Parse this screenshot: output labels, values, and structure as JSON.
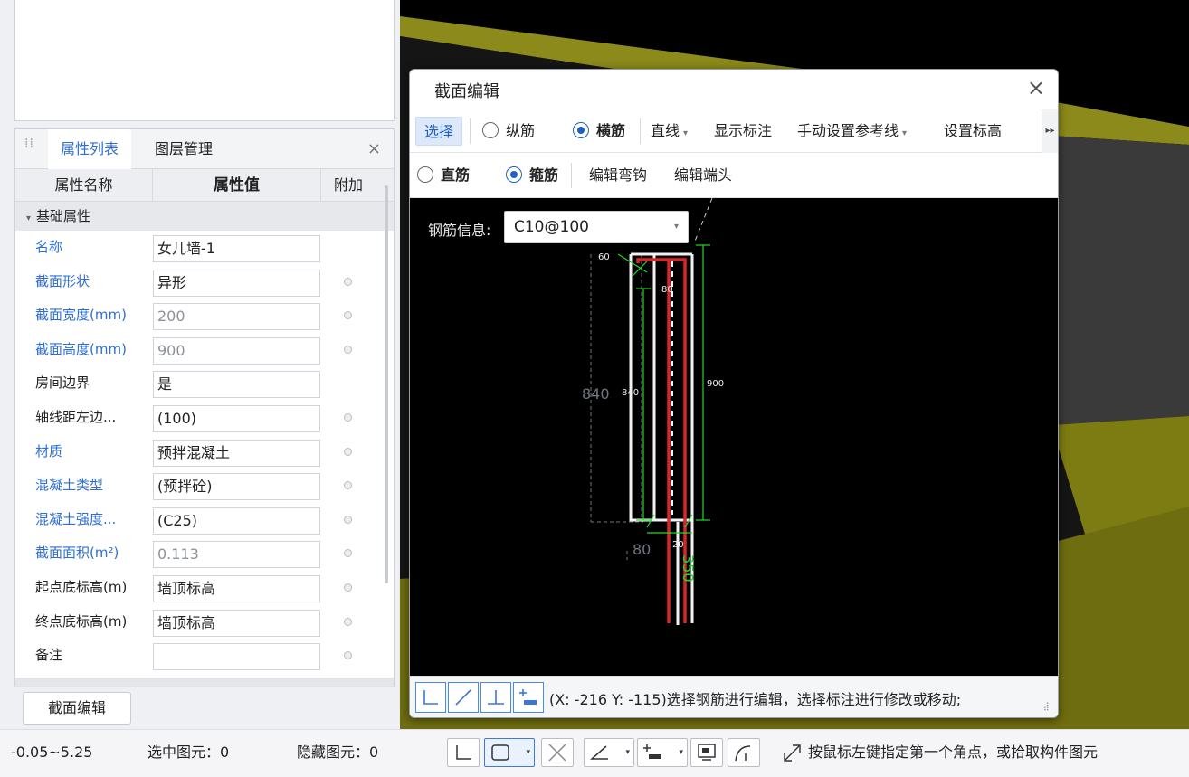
{
  "props_panel": {
    "tabs": {
      "properties": "属性列表",
      "layers": "图层管理"
    },
    "close": "×",
    "headers": {
      "name": "属性名称",
      "value": "属性值",
      "extra": "附加"
    },
    "group": "基础属性",
    "rows": [
      {
        "name": "名称",
        "value": "女儿墙-1"
      },
      {
        "name": "截面形状",
        "value": "异形"
      },
      {
        "name": "截面宽度(mm)",
        "value": "200"
      },
      {
        "name": "截面高度(mm)",
        "value": "900"
      },
      {
        "name": "房间边界",
        "value": "是"
      },
      {
        "name": "轴线距左边...",
        "value": "(100)"
      },
      {
        "name": "材质",
        "value": "预拌混凝土"
      },
      {
        "name": "混凝土类型",
        "value": "(预拌砼)"
      },
      {
        "name": "混凝土强度...",
        "value": "(C25)"
      },
      {
        "name": "截面面积(m²)",
        "value": "0.113"
      },
      {
        "name": "起点底标高(m)",
        "value": "墙顶标高"
      },
      {
        "name": "终点底标高(m)",
        "value": "墙顶标高"
      },
      {
        "name": "备注",
        "value": ""
      }
    ]
  },
  "section_edit_button": "截面编辑",
  "status_bar": {
    "range": "-0.05~5.25",
    "selected": "选中图元：0",
    "hidden": "隐藏图元：0",
    "hint": "按鼠标左键指定第一个角点，或拾取构件图元"
  },
  "dialog": {
    "title": "截面编辑",
    "close": "×",
    "toolbar1": {
      "select": "选择",
      "longitudinal": "纵筋",
      "transverse": "横筋",
      "line": "直线",
      "show_labels": "显示标注",
      "manual_ref_line": "手动设置参考线",
      "set_elevation": "设置标高"
    },
    "toolbar2": {
      "straight": "直筋",
      "stirrup": "箍筋",
      "edit_hook": "编辑弯钩",
      "edit_end": "编辑端头"
    },
    "rebar_info_label": "钢筋信息:",
    "rebar_value": "C10@100",
    "drawing_labels": {
      "top": "60",
      "inner_top": "80",
      "height_gray": "840",
      "height_white": "840",
      "total_height": "900",
      "bottom_gray": "80",
      "bottom_white": "20",
      "bottom_vertical": "350"
    },
    "coord_status": "(X: -216 Y: -115)选择钢筋进行编辑，选择标注进行修改或移动;"
  },
  "colors": {
    "accent": "#2d6fd6",
    "select_bg": "#dde9fb",
    "rebar_red": "#d8262b",
    "dim_green": "#22d82a",
    "wall_olive": "#8b8a1a"
  }
}
